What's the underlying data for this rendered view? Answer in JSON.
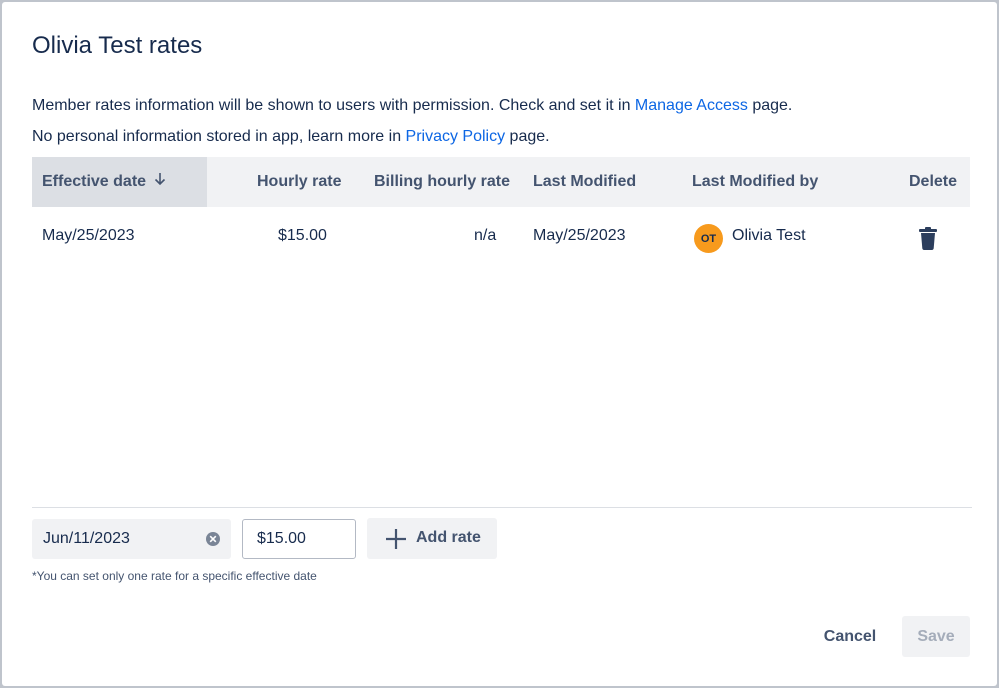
{
  "dialog": {
    "title": "Olivia Test rates",
    "info_line1_prefix": "Member rates information will be shown to users with permission. Check and set it in ",
    "info_line1_link": "Manage Access",
    "info_line1_suffix": " page.",
    "info_line2_prefix": "No personal information stored in app, learn more in ",
    "info_line2_link": "Privacy Policy",
    "info_line2_suffix": " page."
  },
  "table": {
    "columns": [
      "Effective date",
      "Hourly rate",
      "Billing hourly rate",
      "Last Modified",
      "Last Modified by",
      "Delete"
    ],
    "sort_icon": "arrow-down-icon",
    "rows": [
      {
        "effective_date": "May/25/2023",
        "hourly_rate": "$15.00",
        "billing_hourly_rate": "n/a",
        "last_modified": "May/25/2023",
        "avatar_initials": "OT",
        "last_modified_by": "Olivia Test",
        "delete_icon": "trash-icon"
      }
    ]
  },
  "form": {
    "date_value": "Jun/11/2023",
    "rate_value": "$15.00",
    "add_rate_label": "Add rate",
    "hint": "*You can set only one rate for a specific effective date"
  },
  "footer": {
    "cancel_label": "Cancel",
    "save_label": "Save"
  },
  "colors": {
    "link": "#0c66e4",
    "avatar": "#f79a1d",
    "header_bg": "#f1f2f4"
  }
}
